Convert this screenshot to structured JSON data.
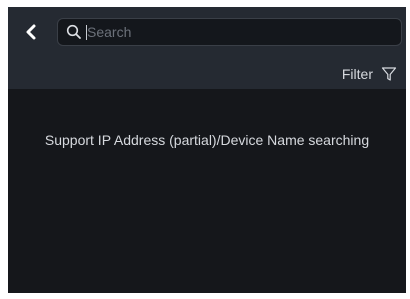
{
  "search": {
    "placeholder": "Search",
    "value": ""
  },
  "filter": {
    "label": "Filter"
  },
  "hint": "Support IP Address (partial)/Device Name searching",
  "icons": {
    "back": "chevron-left-icon",
    "search": "search-icon",
    "filter": "filter-icon"
  },
  "colors": {
    "background": "#15171b",
    "header": "#252a32",
    "text": "#d6d9de"
  }
}
